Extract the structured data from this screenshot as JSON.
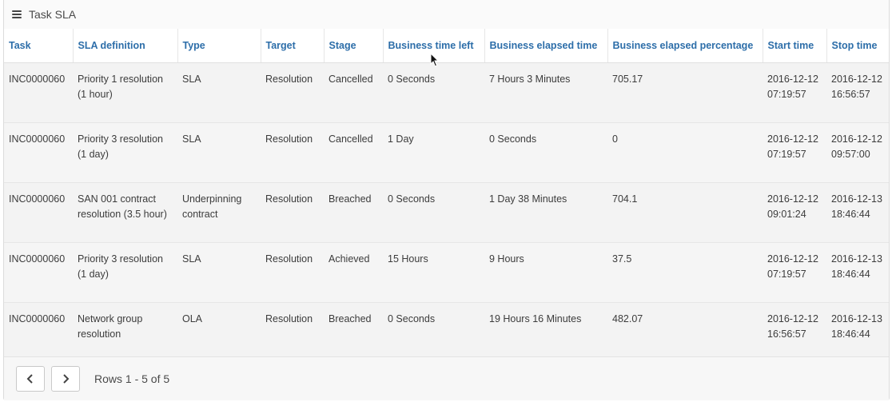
{
  "header": {
    "title": "Task SLA",
    "menu_icon": "hamburger-menu-icon"
  },
  "table": {
    "columns": [
      "Task",
      "SLA definition",
      "Type",
      "Target",
      "Stage",
      "Business time left",
      "Business elapsed time",
      "Business elapsed percentage",
      "Start time",
      "Stop time"
    ],
    "rows": [
      [
        "INC0000060",
        "Priority 1 resolution (1 hour)",
        "SLA",
        "Resolution",
        "Cancelled",
        "0 Seconds",
        "7 Hours 3 Minutes",
        "705.17",
        "2016-12-12 07:19:57",
        "2016-12-12 16:56:57"
      ],
      [
        "INC0000060",
        "Priority 3 resolution (1 day)",
        "SLA",
        "Resolution",
        "Cancelled",
        "1 Day",
        "0 Seconds",
        "0",
        "2016-12-12 07:19:57",
        "2016-12-12 09:57:00"
      ],
      [
        "INC0000060",
        "SAN 001 contract resolution (3.5 hour)",
        "Underpinning contract",
        "Resolution",
        "Breached",
        "0 Seconds",
        "1 Day 38 Minutes",
        "704.1",
        "2016-12-12 09:01:24",
        "2016-12-13 18:46:44"
      ],
      [
        "INC0000060",
        "Priority 3 resolution (1 day)",
        "SLA",
        "Resolution",
        "Achieved",
        "15 Hours",
        "9 Hours",
        "37.5",
        "2016-12-12 07:19:57",
        "2016-12-13 18:46:44"
      ],
      [
        "INC0000060",
        "Network group resolution",
        "OLA",
        "Resolution",
        "Breached",
        "0 Seconds",
        "19 Hours 16 Minutes",
        "482.07",
        "2016-12-12 16:56:57",
        "2016-12-13 18:46:44"
      ]
    ]
  },
  "pagination": {
    "prev_icon": "chevron-left-icon",
    "next_icon": "chevron-right-icon",
    "rows_label": "Rows 1 - 5 of 5"
  },
  "colors": {
    "header_text": "#2d6ea9",
    "row_bg": "#f5f5f5"
  }
}
